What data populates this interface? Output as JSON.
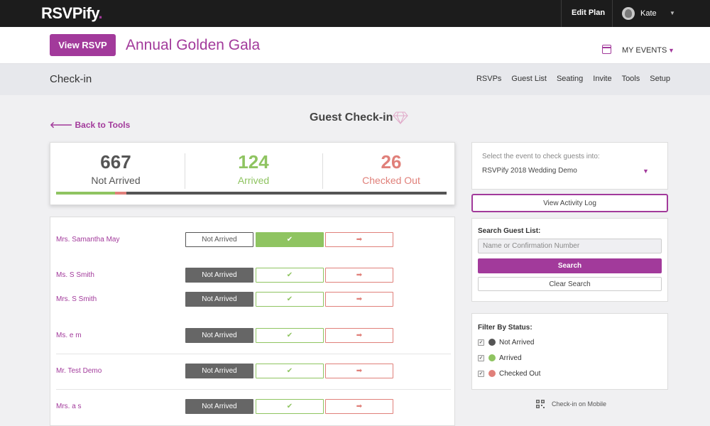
{
  "topbar": {
    "logo_text": "RSVPify",
    "logo_dot": ".",
    "edit_plan": "Edit Plan",
    "user_name": "Kate"
  },
  "event": {
    "view_rsvp": "View RSVP",
    "title": "Annual Golden Gala",
    "my_events": "MY EVENTS"
  },
  "subnav": {
    "section": "Check-in",
    "links": [
      "RSVPs",
      "Guest List",
      "Seating",
      "Invite",
      "Tools",
      "Setup"
    ]
  },
  "page": {
    "back": "Back to Tools",
    "heading": "Guest Check-in"
  },
  "stats": {
    "not_arrived": {
      "value": "667",
      "label": "Not Arrived"
    },
    "arrived": {
      "value": "124",
      "label": "Arrived"
    },
    "checked_out": {
      "value": "26",
      "label": "Checked Out"
    },
    "progress": {
      "arrived_fraction": 0.15,
      "checked_out_fraction": 0.03
    }
  },
  "guests": [
    {
      "name": "Mrs. Samantha May",
      "status": "arrived"
    },
    {
      "name": "Ms. S Smith",
      "status": "not_arrived"
    },
    {
      "name": "Mrs. S Smith",
      "status": "not_arrived"
    },
    {
      "name": "Ms. e m",
      "status": "not_arrived"
    },
    {
      "name": "Mr. Test Demo",
      "status": "not_arrived"
    },
    {
      "name": "Mrs. a s",
      "status": "not_arrived"
    }
  ],
  "guest_buttons": {
    "not_arrived_label": "Not Arrived",
    "arrived_glyph": "✔",
    "checkout_glyph": "➡"
  },
  "event_select": {
    "label": "Select the event to check guests into:",
    "value": "RSVPify 2018 Wedding Demo"
  },
  "activity_log": "View Activity Log",
  "search": {
    "label": "Search Guest List:",
    "placeholder": "Name or Confirmation Number",
    "search_button": "Search",
    "clear_button": "Clear Search"
  },
  "filter": {
    "title": "Filter By Status:",
    "items": [
      {
        "label": "Not Arrived",
        "color": "#555555"
      },
      {
        "label": "Arrived",
        "color": "#8fc461"
      },
      {
        "label": "Checked Out",
        "color": "#e0807a"
      }
    ]
  },
  "mobile": "Check-in on Mobile",
  "colors": {
    "brand": "#a23a9b",
    "arrived": "#8fc461",
    "checked_out": "#e0807a",
    "not_arrived": "#555555"
  }
}
